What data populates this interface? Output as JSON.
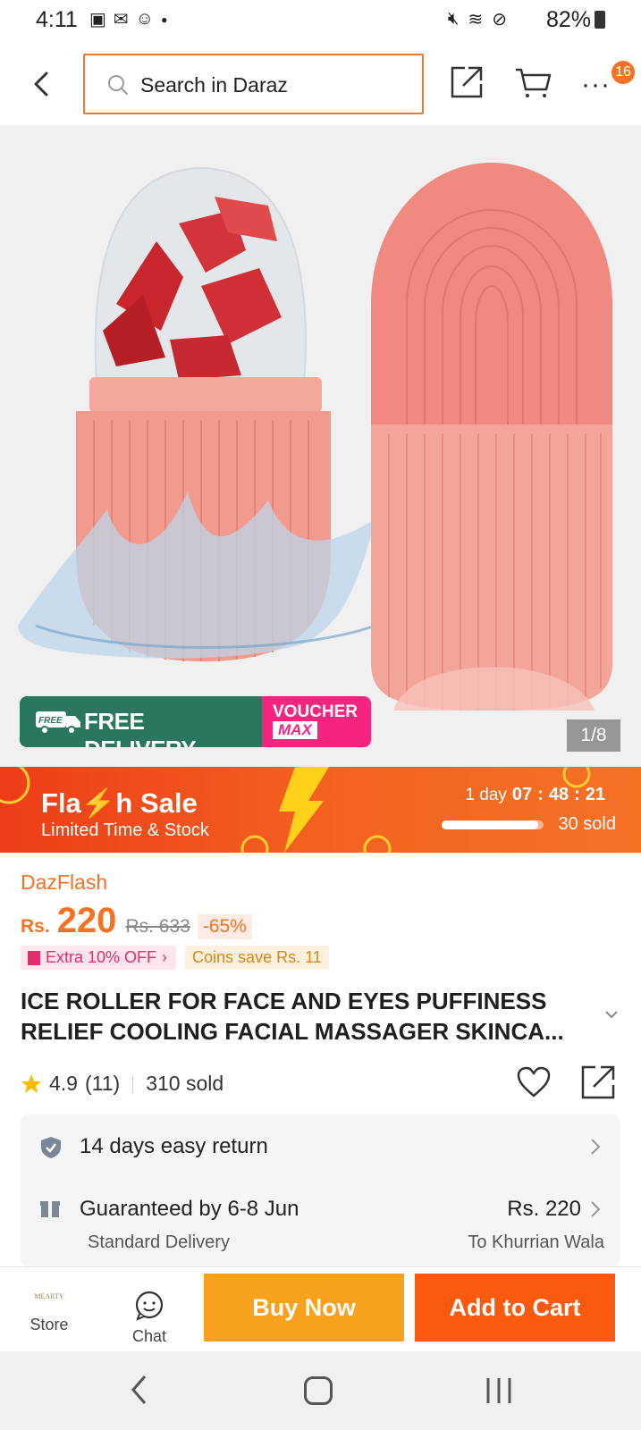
{
  "status_bar": {
    "time": "4:11",
    "battery": "82%"
  },
  "header": {
    "search_placeholder": "Search in Daraz",
    "cart_badge": "16"
  },
  "gallery": {
    "counter": "1/8",
    "promo_free_label": "FREE DELIVERY",
    "promo_free_truck_text": "FREE",
    "promo_voucher_label": "VOUCHER",
    "promo_voucher_sub": "MAX"
  },
  "flash_sale": {
    "title": "Fla⚡h Sale",
    "subtitle": "Limited Time & Stock",
    "countdown_days": "1 day",
    "countdown_hours": "07",
    "countdown_minutes": "48",
    "countdown_seconds": "21",
    "sold": "30 sold",
    "sold_fraction": 0.95
  },
  "product": {
    "channel": "DazFlash",
    "currency": "Rs.",
    "price": "220",
    "old_price": "Rs. 633",
    "discount": "-65%",
    "tag_extra": "Extra 10% OFF",
    "tag_coins": "Coins save Rs. 11",
    "title_line1": "ICE ROLLER FOR FACE AND EYES PUFFINESS",
    "title_line2": "RELIEF COOLING FACIAL MASSAGER SKINCA...",
    "rating": "4.9",
    "rating_count": "(11)",
    "sold": "310 sold"
  },
  "service": {
    "return_text": "14 days easy return",
    "delivery_text": "Guaranteed by 6-8 Jun",
    "delivery_type": "Standard Delivery",
    "delivery_price": "Rs. 220",
    "delivery_to": "To Khurrian Wala"
  },
  "actions": {
    "store_label": "Store",
    "store_logo_text": "MEARTY",
    "chat_label": "Chat",
    "buy_now": "Buy Now",
    "add_to_cart": "Add to Cart"
  },
  "colors": {
    "accent": "#f57224",
    "buy_now": "#f8a11f",
    "add_to_cart": "#f95a0f",
    "free_delivery": "#2a7760",
    "voucher": "#f5257f"
  }
}
